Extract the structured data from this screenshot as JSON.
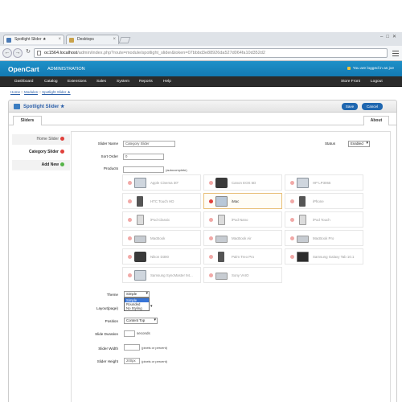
{
  "browser": {
    "tabs": [
      {
        "label": "Spotlight Slider ★"
      },
      {
        "label": "Desktops"
      }
    ],
    "url_host": "oc1564.localhost",
    "url_path": "/admin/index.php?route=module/spotlight_slider&token=07bbbd3e88926da527d064fa10d352d2"
  },
  "header": {
    "logo": "OpenCart",
    "admin_label": "ADMINISTRATION",
    "logged_in": "You are logged in as joe"
  },
  "menu": {
    "left": [
      "Dashboard",
      "Catalog",
      "Extensions",
      "Sales",
      "System",
      "Reports",
      "Help"
    ],
    "store_front": "Store Front",
    "logout": "Logout"
  },
  "breadcrumb": {
    "home": "Home",
    "sep": " :: ",
    "modules": "Modules",
    "current": "Spotlight Slider ★"
  },
  "module": {
    "title": "Spotlight Slider ★",
    "save": "Save",
    "cancel": "Cancel",
    "tab_sliders": "Sliders",
    "tab_about": "About"
  },
  "sliders": {
    "items": [
      {
        "label": "Home Slider"
      },
      {
        "label": "Category Slider"
      }
    ],
    "add_new": "Add New"
  },
  "form": {
    "slider_name_label": "Slider Name",
    "slider_name_value": "Category Slider",
    "status_label": "Status",
    "status_value": "Enabled",
    "sort_order_label": "Sort Order",
    "sort_order_value": "0",
    "products_label": "Products",
    "autocomplete_hint": "(autocomplete)",
    "theme_label": "Theme",
    "theme_value": "Simple",
    "theme_options": [
      "Simple",
      "Rounded",
      "No Styling"
    ],
    "layout_label": "Layout(page)",
    "position_label": "Position",
    "position_value": "Content Top",
    "slide_duration_label": "Slide Duration",
    "slide_duration_unit": "seconds",
    "slider_width_label": "Slider Width",
    "slider_width_hint": "(pixels or percent)",
    "slider_height_label": "Slider Height",
    "slider_height_value": "200px",
    "slider_height_hint": "(pixels or percent)"
  },
  "products": [
    {
      "name": "Apple Cinema 30\"",
      "icon": "monitor-icon",
      "selected": false
    },
    {
      "name": "Canon EOS 5D",
      "icon": "camera-icon",
      "selected": false
    },
    {
      "name": "HP LP3065",
      "icon": "monitor-icon",
      "selected": false
    },
    {
      "name": "HTC Touch HD",
      "icon": "phone-icon",
      "selected": false
    },
    {
      "name": "iMac",
      "icon": "imac-icon",
      "selected": true
    },
    {
      "name": "iPhone",
      "icon": "phone-icon",
      "selected": false
    },
    {
      "name": "iPod Classic",
      "icon": "ipod-icon",
      "selected": false
    },
    {
      "name": "iPod Nano",
      "icon": "ipod-icon",
      "selected": false
    },
    {
      "name": "iPod Touch",
      "icon": "ipod-icon",
      "selected": false
    },
    {
      "name": "MacBook",
      "icon": "laptop-icon",
      "selected": false
    },
    {
      "name": "MacBook Air",
      "icon": "laptop-icon",
      "selected": false
    },
    {
      "name": "MacBook Pro",
      "icon": "laptop-icon",
      "selected": false
    },
    {
      "name": "Nikon D300",
      "icon": "camera-icon",
      "selected": false
    },
    {
      "name": "Palm Treo Pro",
      "icon": "phone-icon",
      "selected": false
    },
    {
      "name": "Samsung Galaxy Tab 10.1",
      "icon": "tablet-icon",
      "selected": false
    },
    {
      "name": "Samsung SyncMaster 94...",
      "icon": "monitor-icon",
      "selected": false
    },
    {
      "name": "Sony VAIO",
      "icon": "laptop-icon",
      "selected": false
    }
  ],
  "colors": {
    "header_blue": "#1a86c0",
    "menu_dark": "#2b2b2b",
    "button_blue": "#1f67b0",
    "remove_red": "#e0403b",
    "add_green": "#56b448"
  }
}
